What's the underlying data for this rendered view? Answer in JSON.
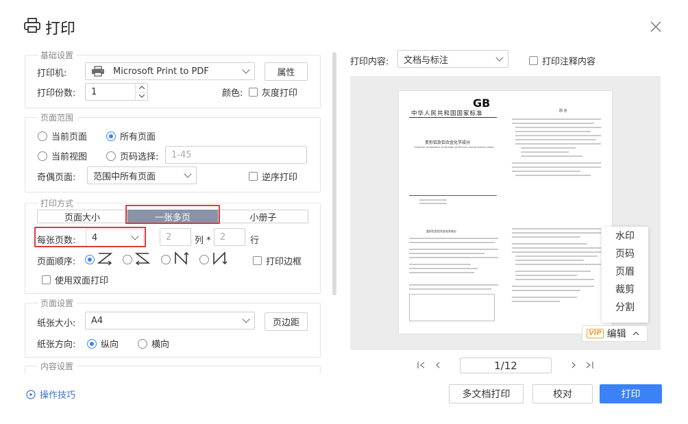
{
  "dialog": {
    "title": "打印"
  },
  "basic": {
    "legend": "基础设置",
    "printer_label": "打印机:",
    "printer_value": "Microsoft Print to PDF",
    "properties_button": "属性",
    "copies_label": "打印份数:",
    "copies_value": "1",
    "color_label": "颜色:",
    "grayscale_label": "灰度打印"
  },
  "range": {
    "legend": "页面范围",
    "current_page": "当前页面",
    "all_pages": "所有页面",
    "current_view": "当前视图",
    "page_select": "页码选择:",
    "page_select_placeholder": "1-45",
    "odd_even_label": "奇偶页面:",
    "odd_even_value": "范围中所有页面",
    "reverse_label": "逆序打印",
    "selected": "all_pages"
  },
  "mode": {
    "legend": "打印方式",
    "tabs": [
      "页面大小",
      "一张多页",
      "小册子"
    ],
    "active_tab": "一张多页",
    "per_sheet_label": "每张页数:",
    "per_sheet_value": "4",
    "cols_value": "2",
    "cols_label": "列 *",
    "rows_value": "2",
    "rows_label": "行",
    "order_label": "页面顺序:",
    "border_label": "打印边框",
    "duplex_label": "使用双面打印"
  },
  "page_setup": {
    "legend": "页面设置",
    "paper_size_label": "纸张大小:",
    "paper_size_value": "A4",
    "margins_button": "页边距",
    "orientation_label": "纸张方向:",
    "portrait": "纵向",
    "landscape": "横向",
    "selected": "portrait"
  },
  "content_settings": {
    "legend": "内容设置"
  },
  "preview": {
    "content_label": "打印内容:",
    "content_value": "文档与标注",
    "print_annotations_label": "打印注释内容",
    "page_indicator": "1/12",
    "doc": {
      "logo": "GB",
      "heading": "中华人民共和国国家标准",
      "subtitle": "变形铝及铝合金化学成分",
      "subtitle_en": "Chemical composition of wrought aluminium and aluminium alloys",
      "front_heading": "前    言",
      "second_title": "变形铝及铝合金化学成分"
    },
    "context_menu": [
      "水印",
      "页码",
      "页眉",
      "裁剪",
      "分割"
    ],
    "edit_vip": "VIP",
    "edit_label": "编辑"
  },
  "footer": {
    "tips": "操作技巧",
    "multi_doc": "多文档打印",
    "proof": "校对",
    "print": "打印"
  },
  "colors": {
    "accent": "#3b82f6",
    "highlight": "#e03a3a",
    "tab_active": "#8a93a8"
  }
}
